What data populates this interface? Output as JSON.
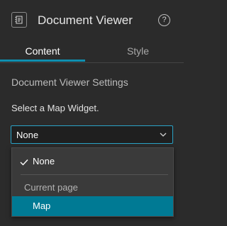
{
  "header": {
    "title": "Document Viewer",
    "icon": "widget-book-icon",
    "help_icon_glyph": "?"
  },
  "tabs": [
    {
      "label": "Content",
      "active": true
    },
    {
      "label": "Style",
      "active": false
    }
  ],
  "settings": {
    "section_title": "Document Viewer Settings",
    "field_label": "Select a Map Widget.",
    "selected_value": "None"
  },
  "dropdown": {
    "options": [
      {
        "label": "None",
        "checked": true
      },
      {
        "group_header": "Current page"
      },
      {
        "label": "Map",
        "highlighted": true
      }
    ]
  },
  "colors": {
    "background": "#2b2b2b",
    "accent": "#0f8fb0",
    "highlight": "#007a94",
    "select_border": "#2aa3c7"
  }
}
